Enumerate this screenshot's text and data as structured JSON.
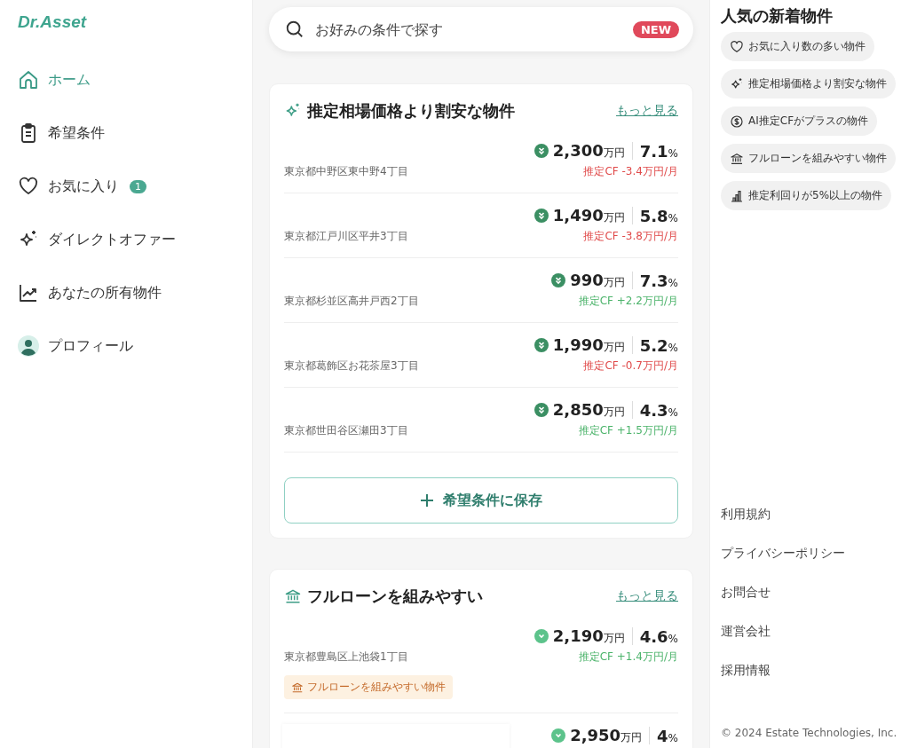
{
  "logo": "Dr.Asset",
  "nav": [
    {
      "label": "ホーム",
      "kind": "home",
      "selected": true
    },
    {
      "label": "希望条件",
      "kind": "clipboard",
      "selected": false
    },
    {
      "label": "お気に入り",
      "kind": "heart",
      "selected": false,
      "badge": "1"
    },
    {
      "label": "ダイレクトオファー",
      "kind": "sparkle",
      "selected": false
    },
    {
      "label": "あなたの所有物件",
      "kind": "chart",
      "selected": false
    },
    {
      "label": "プロフィール",
      "kind": "avatar",
      "selected": false
    }
  ],
  "search": {
    "placeholder": "お好みの条件で探す",
    "badge": "NEW"
  },
  "sections": [
    {
      "title": "推定相場価格より割安な物件",
      "kind": "sparkle",
      "more": "もっと見る",
      "save_button": "希望条件に保存",
      "listings": [
        {
          "kind": "double",
          "price": "2,300",
          "price_unit": "万円",
          "yield": "7.1",
          "yield_unit": "%",
          "address": "東京都中野区東中野4丁目",
          "cf": "推定CF -3.4万円/月",
          "cf_positive": false
        },
        {
          "kind": "double",
          "price": "1,490",
          "price_unit": "万円",
          "yield": "5.8",
          "yield_unit": "%",
          "address": "東京都江戸川区平井3丁目",
          "cf": "推定CF -3.8万円/月",
          "cf_positive": false
        },
        {
          "kind": "double",
          "price": "990",
          "price_unit": "万円",
          "yield": "7.3",
          "yield_unit": "%",
          "address": "東京都杉並区高井戸西2丁目",
          "cf": "推定CF +2.2万円/月",
          "cf_positive": true
        },
        {
          "kind": "double",
          "price": "1,990",
          "price_unit": "万円",
          "yield": "5.2",
          "yield_unit": "%",
          "address": "東京都葛飾区お花茶屋3丁目",
          "cf": "推定CF -0.7万円/月",
          "cf_positive": false
        },
        {
          "kind": "double",
          "price": "2,850",
          "price_unit": "万円",
          "yield": "4.3",
          "yield_unit": "%",
          "address": "東京都世田谷区瀬田3丁目",
          "cf": "推定CF +1.5万円/月",
          "cf_positive": true
        }
      ]
    },
    {
      "title": "フルローンを組みやすい",
      "kind": "bank",
      "more": "もっと見る",
      "listings": [
        {
          "kind": "single",
          "price": "2,190",
          "price_unit": "万円",
          "yield": "4.6",
          "yield_unit": "%",
          "address": "東京都豊島区上池袋1丁目",
          "cf": "推定CF +1.4万円/月",
          "cf_positive": true,
          "tag": "フルローンを組みやすい物件"
        },
        {
          "kind": "single",
          "price": "2,950",
          "price_unit": "万円",
          "yield": "4",
          "yield_unit": "%",
          "covered": true
        }
      ]
    }
  ],
  "popular": {
    "title": "人気の新着物件",
    "chips": [
      {
        "label": "お気に入り数の多い物件",
        "kind": "heart"
      },
      {
        "label": "推定相場価格より割安な物件",
        "kind": "sparkle"
      },
      {
        "label": "AI推定CFがプラスの物件",
        "kind": "dollar"
      },
      {
        "label": "フルローンを組みやすい物件",
        "kind": "bank"
      },
      {
        "label": "推定利回りが5%以上の物件",
        "kind": "bars"
      }
    ]
  },
  "footer_links": [
    "利用規約",
    "プライバシーポリシー",
    "お問合せ",
    "運営会社",
    "採用情報"
  ],
  "copyright": "© 2024 Estate Technologies, Inc."
}
